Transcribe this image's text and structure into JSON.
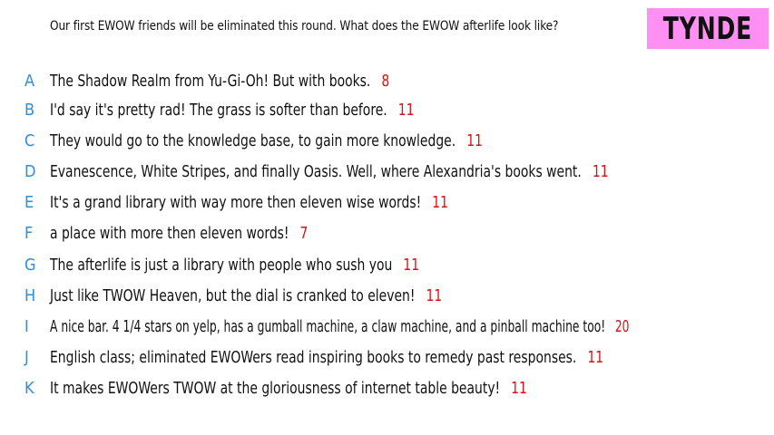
{
  "prompt": "Our first EWOW friends will be eliminated this round. What does the EWOW afterlife look like?",
  "badge": {
    "label": "TYNDE",
    "color": "#ff8ff2"
  },
  "colors": {
    "letter": "#2a8fe0",
    "count": "#e01010"
  },
  "responses": [
    {
      "letter": "A",
      "text": "The Shadow Realm from Yu-Gi-Oh! But with books.",
      "count": "8"
    },
    {
      "letter": "B",
      "text": "I'd say it's pretty rad! The grass is softer than before.",
      "count": "11"
    },
    {
      "letter": "C",
      "text": "They would go to the knowledge base, to gain more knowledge.",
      "count": "11"
    },
    {
      "letter": "D",
      "text": "Evanescence, White Stripes, and finally Oasis. Well, where Alexandria's books went.",
      "count": "11"
    },
    {
      "letter": "E",
      "text": "It's a grand library with way more then eleven wise words!",
      "count": "11"
    },
    {
      "letter": "F",
      "text": "a place with more then eleven words!",
      "count": "7"
    },
    {
      "letter": "G",
      "text": "The afterlife is just a library with people who sush you",
      "count": "11"
    },
    {
      "letter": "H",
      "text": "Just like TWOW Heaven, but the dial is cranked to eleven!",
      "count": "11"
    },
    {
      "letter": "I",
      "text": "A nice bar. 4 1/4 stars on yelp, has a gumball machine, a claw machine, and a pinball machine too!",
      "count": "20"
    },
    {
      "letter": "J",
      "text": "English class; eliminated EWOWers read inspiring books to remedy past responses.",
      "count": "11"
    },
    {
      "letter": "K",
      "text": "It makes EWOWers TWOW at the gloriousness of internet table beauty!",
      "count": "11"
    }
  ]
}
